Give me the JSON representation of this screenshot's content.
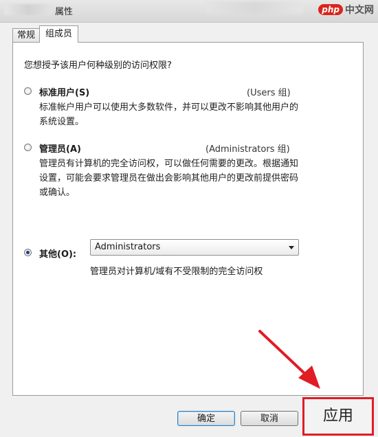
{
  "window": {
    "title_suffix": "属性",
    "watermark_logo": "php",
    "watermark_text": "中文网"
  },
  "tabs": [
    {
      "label": "常规",
      "active": false
    },
    {
      "label": "组成员",
      "active": true
    }
  ],
  "panel": {
    "question": "您想授予该用户何种级别的访问权限?",
    "options": [
      {
        "label": "标准用户(S)",
        "group": "(Users 组)",
        "description": "标准帐户用户可以使用大多数软件，并可以更改不影响其他用户的系统设置。",
        "checked": false
      },
      {
        "label": "管理员(A)",
        "group": "(Administrators 组)",
        "description": "管理员有计算机的完全访问权，可以做任何需要的更改。根据通知设置，可能会要求管理员在做出会影响其他用户的更改前提供密码或确认。",
        "checked": false
      },
      {
        "label": "其他(O):",
        "checked": true
      }
    ],
    "other_select_value": "Administrators",
    "other_description": "管理员对计算机/域有不受限制的完全访问权"
  },
  "buttons": {
    "ok": "确定",
    "cancel": "取消",
    "apply": "应用"
  },
  "colors": {
    "highlight": "#e01c24",
    "arrow": "#e01c24"
  }
}
